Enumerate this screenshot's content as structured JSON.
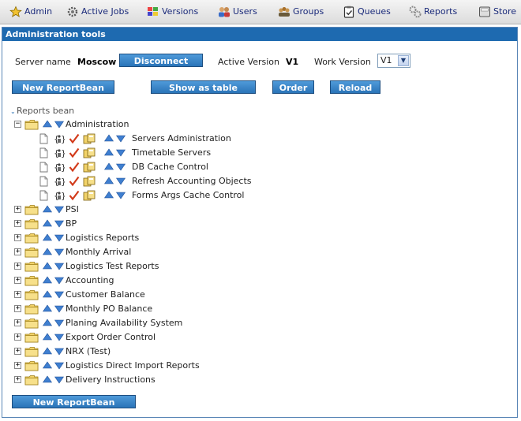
{
  "nav": {
    "items": [
      {
        "label": "Admin",
        "icon": "star-icon"
      },
      {
        "label": "Active Jobs",
        "icon": "gear-icon"
      },
      {
        "label": "Versions",
        "icon": "versions-icon"
      },
      {
        "label": "Users",
        "icon": "users-icon"
      },
      {
        "label": "Groups",
        "icon": "groups-icon"
      },
      {
        "label": "Queues",
        "icon": "queues-icon"
      },
      {
        "label": "Reports",
        "icon": "reports-icon"
      },
      {
        "label": "Store",
        "icon": "store-icon"
      }
    ]
  },
  "panel": {
    "title": "Administration tools",
    "server_label": "Server name",
    "server_name": "Moscow",
    "disconnect_label": "Disconnect",
    "active_version_label": "Active Version",
    "active_version": "V1",
    "work_version_label": "Work Version",
    "work_version": "V1"
  },
  "toolbar": {
    "new_reportbean": "New ReportBean",
    "show_as_table": "Show as table",
    "order": "Order",
    "reload": "Reload"
  },
  "tree": {
    "root_label": "Reports bean",
    "expanded": {
      "label": "Administration",
      "children": [
        "Servers Administration",
        "Timetable Servers",
        "DB Cache Control",
        "Refresh Accounting Objects",
        "Forms Args Cache Control"
      ]
    },
    "collapsed": [
      "PSI",
      "BP",
      "Logistics Reports",
      "Monthly Arrival",
      "Logistics Test Reports",
      "Accounting",
      "Customer Balance",
      "Monthly PO Balance",
      "Planing Availability System",
      "Export Order Control",
      "NRX (Test)",
      "Logistics Direct Import Reports",
      "Delivery Instructions"
    ]
  },
  "footer": {
    "new_reportbean": "New ReportBean"
  },
  "colors": {
    "header_blue": "#1e6ab0",
    "button_blue": "#3a86c9",
    "folder_yellow": "#f2d36a",
    "check_red": "#d23a1a"
  }
}
